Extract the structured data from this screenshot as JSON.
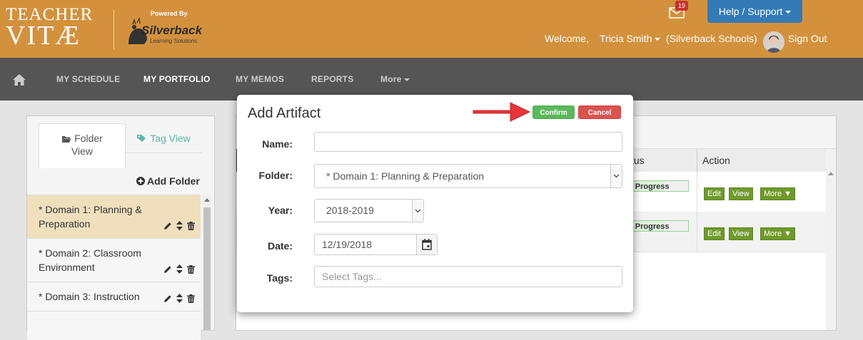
{
  "header": {
    "logo_line1": "TEACHER",
    "logo_line2": "VITÆ",
    "powered_by": "Powered By",
    "partner_name": "Silverback",
    "partner_sub": "Learning Solutions",
    "mail_count": "19",
    "help_label": "Help / Support",
    "welcome": "Welcome,",
    "user_name": "Tricia Smith",
    "school": "(Silverback Schools)",
    "sign_out": "Sign Out",
    "colors": {
      "bar": "#d3913d",
      "help": "#337ab7"
    }
  },
  "nav": {
    "items": [
      {
        "label": "MY SCHEDULE"
      },
      {
        "label": "MY PORTFOLIO"
      },
      {
        "label": "MY MEMOS"
      },
      {
        "label": "REPORTS"
      },
      {
        "label": "More"
      }
    ],
    "active": "MY PORTFOLIO"
  },
  "left_panel": {
    "tab_folder": "Folder View",
    "tab_folder_line1": "Folder",
    "tab_folder_line2": "View",
    "tab_tag": "Tag View",
    "add_folder": "Add Folder",
    "folders": [
      {
        "line1": "* Domain 1: Planning &",
        "line2": "Preparation",
        "selected": true
      },
      {
        "line1": "* Domain 2: Classroom",
        "line2": "Environment",
        "selected": false
      },
      {
        "line1": "* Domain 3: Instruction",
        "line2": "",
        "selected": false
      }
    ]
  },
  "table": {
    "col_status": "tus",
    "col_action": "Action",
    "rows": [
      {
        "status": "n Progress",
        "actions": [
          "Edit",
          "View",
          "More ▼"
        ]
      },
      {
        "status": "n Progress",
        "actions": [
          "Edit",
          "View",
          "More ▼"
        ]
      }
    ]
  },
  "dialog": {
    "title": "Add Artifact",
    "confirm": "Confirm",
    "cancel": "Cancel",
    "fields": {
      "name_label": "Name:",
      "name_value": "",
      "folder_label": "Folder:",
      "folder_value": "* Domain 1: Planning & Preparation",
      "year_label": "Year:",
      "year_value": "2018-2019",
      "date_label": "Date:",
      "date_value": "12/19/2018",
      "tags_label": "Tags:",
      "tags_placeholder": "Select Tags..."
    },
    "colors": {
      "confirm": "#5cb85c",
      "cancel": "#d9534f"
    }
  },
  "annotation": {
    "arrow_color": "#e8333a",
    "icon": "red-arrow-pointing-right"
  }
}
